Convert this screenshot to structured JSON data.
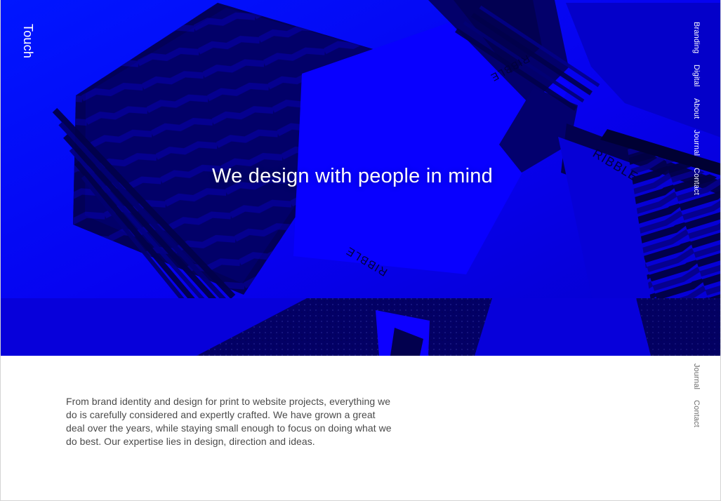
{
  "header": {
    "brand": "Touch"
  },
  "hero": {
    "headline": "We design with people in mind",
    "image_brand_text": "RIBBLE",
    "background_color": "#0a00f0"
  },
  "nav": {
    "primary": [
      {
        "label": "Branding"
      },
      {
        "label": "Digital"
      },
      {
        "label": "About"
      },
      {
        "label": "Journal"
      },
      {
        "label": "Contact"
      }
    ],
    "secondary": [
      {
        "label": "Journal"
      },
      {
        "label": "Contact"
      }
    ]
  },
  "intro": {
    "paragraph": "From brand identity and design for print to website projects, everything we do is carefully considered and expertly crafted. We have grown a great deal over the years, while staying small enough to focus on doing what we do best. Our expertise lies in design, direction and ideas."
  },
  "colors": {
    "accent_blue": "#0a00f0",
    "page_background": "#ffffff",
    "text_gray": "#4a4a4a"
  }
}
